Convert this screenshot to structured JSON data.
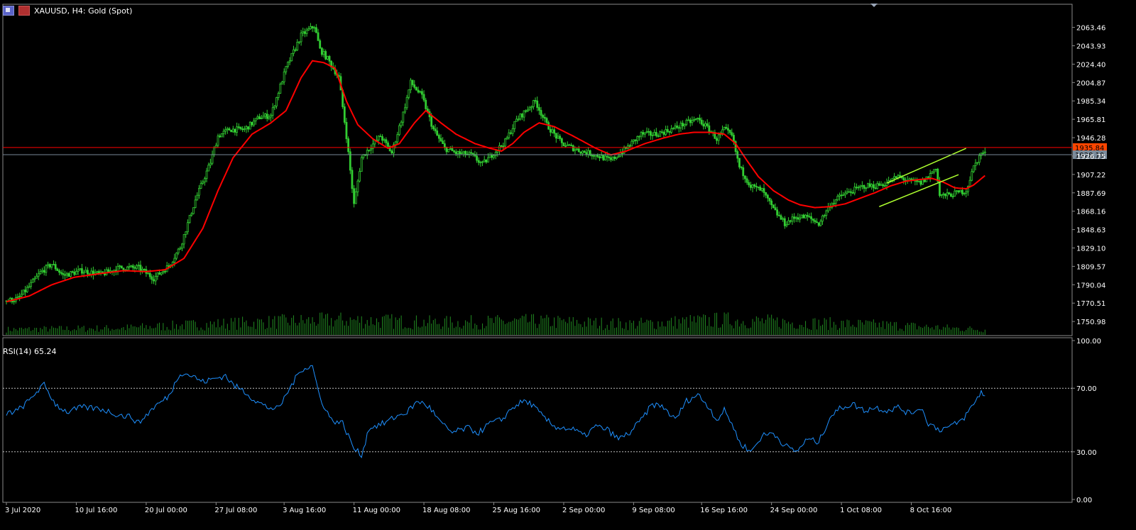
{
  "header": {
    "symbol": "XAUUSD",
    "timeframe": "H4:",
    "instrument": "Gold (Spot)",
    "title": "XAUUSD, H4:  Gold (Spot)"
  },
  "rsi_label": "RSI(14) 65.24",
  "colors": {
    "background": "#000000",
    "candle": "#32cd32",
    "ma": "#ff0000",
    "channel": "#adff2f",
    "volume": "#228b22",
    "rsi": "#1e90ff",
    "hline_red": "#ff0000",
    "hline_gray": "#778899",
    "price_tag_red": "#ff4500",
    "price_tag_gray": "#7b8c9c"
  },
  "chart_data": {
    "type": "candlestick",
    "symbol": "XAUUSD",
    "timeframe": "H4",
    "ylim": [
      1736,
      2082
    ],
    "y_ticks": [
      "2063.46",
      "2043.93",
      "2024.40",
      "2004.87",
      "1985.34",
      "1965.81",
      "1946.28",
      "1926.75",
      "1907.22",
      "1887.69",
      "1868.16",
      "1848.63",
      "1829.10",
      "1809.57",
      "1790.04",
      "1770.51",
      "1750.98"
    ],
    "x_ticks": [
      "3 Jul 2020",
      "10 Jul 16:00",
      "20 Jul 00:00",
      "27 Jul 08:00",
      "3 Aug 16:00",
      "11 Aug 00:00",
      "18 Aug 08:00",
      "25 Aug 16:00",
      "2 Sep 00:00",
      "9 Sep 08:00",
      "16 Sep 16:00",
      "24 Sep 00:00",
      "1 Oct 08:00",
      "8 Oct 16:00"
    ],
    "price_anchors": [
      [
        0,
        1773
      ],
      [
        6,
        1775
      ],
      [
        12,
        1788
      ],
      [
        18,
        1803
      ],
      [
        24,
        1812
      ],
      [
        30,
        1800
      ],
      [
        40,
        1805
      ],
      [
        50,
        1801
      ],
      [
        60,
        1808
      ],
      [
        70,
        1808
      ],
      [
        78,
        1797
      ],
      [
        86,
        1810
      ],
      [
        92,
        1830
      ],
      [
        100,
        1880
      ],
      [
        108,
        1920
      ],
      [
        112,
        1948
      ],
      [
        118,
        1955
      ],
      [
        126,
        1955
      ],
      [
        134,
        1968
      ],
      [
        140,
        1970
      ],
      [
        148,
        2020
      ],
      [
        156,
        2055
      ],
      [
        163,
        2065
      ],
      [
        166,
        2040
      ],
      [
        170,
        2030
      ],
      [
        176,
        2010
      ],
      [
        180,
        1948
      ],
      [
        184,
        1875
      ],
      [
        188,
        1925
      ],
      [
        192,
        1935
      ],
      [
        198,
        1948
      ],
      [
        204,
        1930
      ],
      [
        210,
        1972
      ],
      [
        214,
        2005
      ],
      [
        220,
        1990
      ],
      [
        226,
        1955
      ],
      [
        232,
        1935
      ],
      [
        238,
        1930
      ],
      [
        246,
        1928
      ],
      [
        252,
        1918
      ],
      [
        258,
        1930
      ],
      [
        264,
        1942
      ],
      [
        270,
        1965
      ],
      [
        276,
        1977
      ],
      [
        280,
        1985
      ],
      [
        286,
        1960
      ],
      [
        294,
        1940
      ],
      [
        304,
        1932
      ],
      [
        312,
        1928
      ],
      [
        320,
        1922
      ],
      [
        328,
        1935
      ],
      [
        336,
        1950
      ],
      [
        344,
        1950
      ],
      [
        352,
        1955
      ],
      [
        360,
        1962
      ],
      [
        366,
        1966
      ],
      [
        372,
        1955
      ],
      [
        376,
        1945
      ],
      [
        380,
        1955
      ],
      [
        384,
        1948
      ],
      [
        388,
        1915
      ],
      [
        394,
        1895
      ],
      [
        400,
        1890
      ],
      [
        406,
        1870
      ],
      [
        412,
        1855
      ],
      [
        418,
        1862
      ],
      [
        424,
        1862
      ],
      [
        430,
        1855
      ],
      [
        436,
        1875
      ],
      [
        442,
        1885
      ],
      [
        448,
        1890
      ],
      [
        454,
        1895
      ],
      [
        460,
        1895
      ],
      [
        466,
        1898
      ],
      [
        472,
        1905
      ],
      [
        478,
        1900
      ],
      [
        484,
        1898
      ],
      [
        488,
        1905
      ],
      [
        492,
        1915
      ],
      [
        494,
        1885
      ],
      [
        498,
        1885
      ],
      [
        504,
        1888
      ],
      [
        508,
        1890
      ],
      [
        512,
        1915
      ],
      [
        516,
        1930
      ],
      [
        518,
        1929
      ]
    ],
    "volume_anchors": [
      [
        0,
        8
      ],
      [
        60,
        10
      ],
      [
        100,
        15
      ],
      [
        150,
        20
      ],
      [
        180,
        22
      ],
      [
        230,
        18
      ],
      [
        280,
        20
      ],
      [
        330,
        16
      ],
      [
        380,
        22
      ],
      [
        420,
        18
      ],
      [
        470,
        14
      ],
      [
        500,
        10
      ],
      [
        518,
        8
      ]
    ],
    "rsi_anchors": [
      [
        0,
        54
      ],
      [
        6,
        56
      ],
      [
        12,
        62
      ],
      [
        16,
        68
      ],
      [
        20,
        72
      ],
      [
        26,
        60
      ],
      [
        32,
        55
      ],
      [
        40,
        58
      ],
      [
        50,
        57
      ],
      [
        60,
        53
      ],
      [
        66,
        52
      ],
      [
        70,
        48
      ],
      [
        78,
        58
      ],
      [
        86,
        65
      ],
      [
        92,
        80
      ],
      [
        98,
        78
      ],
      [
        104,
        74
      ],
      [
        110,
        76
      ],
      [
        116,
        78
      ],
      [
        120,
        72
      ],
      [
        126,
        68
      ],
      [
        132,
        62
      ],
      [
        138,
        58
      ],
      [
        144,
        57
      ],
      [
        150,
        70
      ],
      [
        156,
        82
      ],
      [
        162,
        84
      ],
      [
        166,
        64
      ],
      [
        172,
        50
      ],
      [
        178,
        48
      ],
      [
        184,
        32
      ],
      [
        188,
        28
      ],
      [
        192,
        45
      ],
      [
        200,
        48
      ],
      [
        206,
        52
      ],
      [
        212,
        55
      ],
      [
        218,
        62
      ],
      [
        224,
        58
      ],
      [
        230,
        48
      ],
      [
        236,
        42
      ],
      [
        244,
        45
      ],
      [
        250,
        42
      ],
      [
        256,
        48
      ],
      [
        262,
        50
      ],
      [
        268,
        58
      ],
      [
        274,
        62
      ],
      [
        278,
        60
      ],
      [
        284,
        52
      ],
      [
        290,
        46
      ],
      [
        300,
        44
      ],
      [
        306,
        40
      ],
      [
        312,
        46
      ],
      [
        318,
        44
      ],
      [
        324,
        38
      ],
      [
        330,
        42
      ],
      [
        336,
        50
      ],
      [
        342,
        60
      ],
      [
        348,
        58
      ],
      [
        354,
        50
      ],
      [
        360,
        62
      ],
      [
        366,
        66
      ],
      [
        372,
        58
      ],
      [
        376,
        50
      ],
      [
        380,
        56
      ],
      [
        384,
        48
      ],
      [
        388,
        36
      ],
      [
        394,
        30
      ],
      [
        400,
        40
      ],
      [
        406,
        42
      ],
      [
        412,
        34
      ],
      [
        418,
        30
      ],
      [
        424,
        38
      ],
      [
        430,
        36
      ],
      [
        436,
        52
      ],
      [
        442,
        58
      ],
      [
        448,
        60
      ],
      [
        454,
        56
      ],
      [
        460,
        58
      ],
      [
        466,
        56
      ],
      [
        472,
        58
      ],
      [
        478,
        54
      ],
      [
        484,
        58
      ],
      [
        488,
        48
      ],
      [
        494,
        44
      ],
      [
        500,
        46
      ],
      [
        506,
        50
      ],
      [
        512,
        60
      ],
      [
        516,
        68
      ],
      [
        518,
        65
      ]
    ],
    "ma_anchors": [
      [
        0,
        1772
      ],
      [
        12,
        1778
      ],
      [
        24,
        1790
      ],
      [
        36,
        1798
      ],
      [
        50,
        1802
      ],
      [
        62,
        1805
      ],
      [
        74,
        1804
      ],
      [
        84,
        1806
      ],
      [
        94,
        1818
      ],
      [
        104,
        1850
      ],
      [
        112,
        1890
      ],
      [
        120,
        1925
      ],
      [
        130,
        1950
      ],
      [
        140,
        1962
      ],
      [
        148,
        1975
      ],
      [
        156,
        2010
      ],
      [
        162,
        2028
      ],
      [
        168,
        2026
      ],
      [
        174,
        2020
      ],
      [
        180,
        1985
      ],
      [
        186,
        1960
      ],
      [
        194,
        1945
      ],
      [
        202,
        1935
      ],
      [
        208,
        1940
      ],
      [
        216,
        1962
      ],
      [
        222,
        1975
      ],
      [
        230,
        1962
      ],
      [
        238,
        1950
      ],
      [
        248,
        1940
      ],
      [
        256,
        1935
      ],
      [
        262,
        1932
      ],
      [
        268,
        1940
      ],
      [
        274,
        1952
      ],
      [
        282,
        1962
      ],
      [
        290,
        1958
      ],
      [
        300,
        1948
      ],
      [
        312,
        1935
      ],
      [
        320,
        1928
      ],
      [
        328,
        1932
      ],
      [
        338,
        1940
      ],
      [
        348,
        1946
      ],
      [
        356,
        1950
      ],
      [
        364,
        1952
      ],
      [
        372,
        1952
      ],
      [
        380,
        1950
      ],
      [
        386,
        1940
      ],
      [
        392,
        1922
      ],
      [
        398,
        1905
      ],
      [
        406,
        1890
      ],
      [
        414,
        1880
      ],
      [
        420,
        1875
      ],
      [
        428,
        1872
      ],
      [
        436,
        1873
      ],
      [
        444,
        1876
      ],
      [
        452,
        1882
      ],
      [
        460,
        1888
      ],
      [
        468,
        1895
      ],
      [
        476,
        1900
      ],
      [
        484,
        1902
      ],
      [
        490,
        1903
      ],
      [
        496,
        1899
      ],
      [
        502,
        1893
      ],
      [
        508,
        1892
      ],
      [
        512,
        1896
      ],
      [
        518,
        1906
      ]
    ],
    "n_bars": 519,
    "series": [
      {
        "name": "RSI(14)",
        "last": 65.24,
        "levels": [
          30,
          70
        ],
        "ylim": [
          0,
          100
        ],
        "ticks": [
          "100.00",
          "70.00",
          "30.00",
          "0.00"
        ]
      }
    ],
    "hlines": [
      {
        "label": "1935.84",
        "value": 1935.84,
        "color": "#ff0000",
        "tag": "#ff4500"
      },
      {
        "label": "1928.19",
        "value": 1928.19,
        "color": "#778899",
        "tag": "#7b8c9c"
      }
    ],
    "channel": {
      "upper": [
        [
          466,
          1898
        ],
        [
          508,
          1935
        ]
      ],
      "lower": [
        [
          462,
          1873
        ],
        [
          504,
          1907
        ]
      ]
    }
  }
}
